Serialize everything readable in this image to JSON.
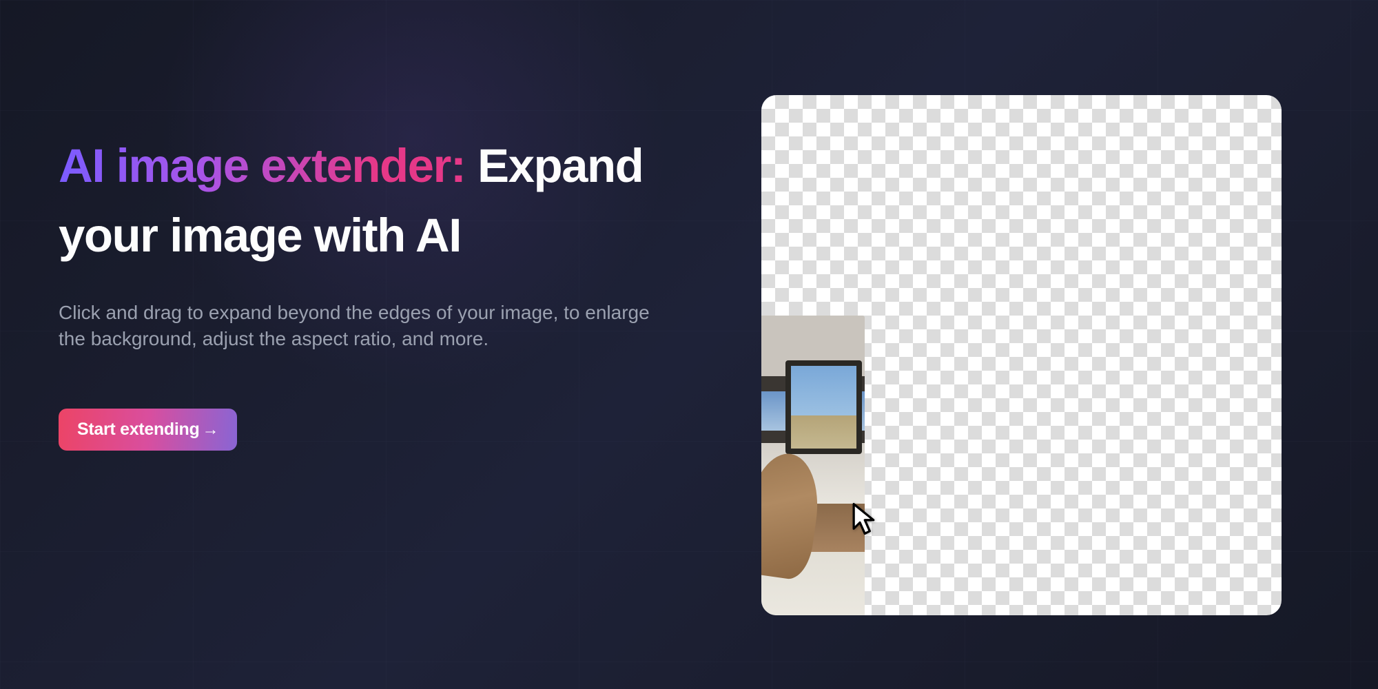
{
  "hero": {
    "title_gradient": "AI image extender:",
    "title_rest": " Expand your image with AI",
    "description": "Click and drag to expand beyond the edges of your image, to enlarge the background, adjust the aspect ratio, and more.",
    "cta_label": "Start extending",
    "cta_arrow": "→"
  }
}
